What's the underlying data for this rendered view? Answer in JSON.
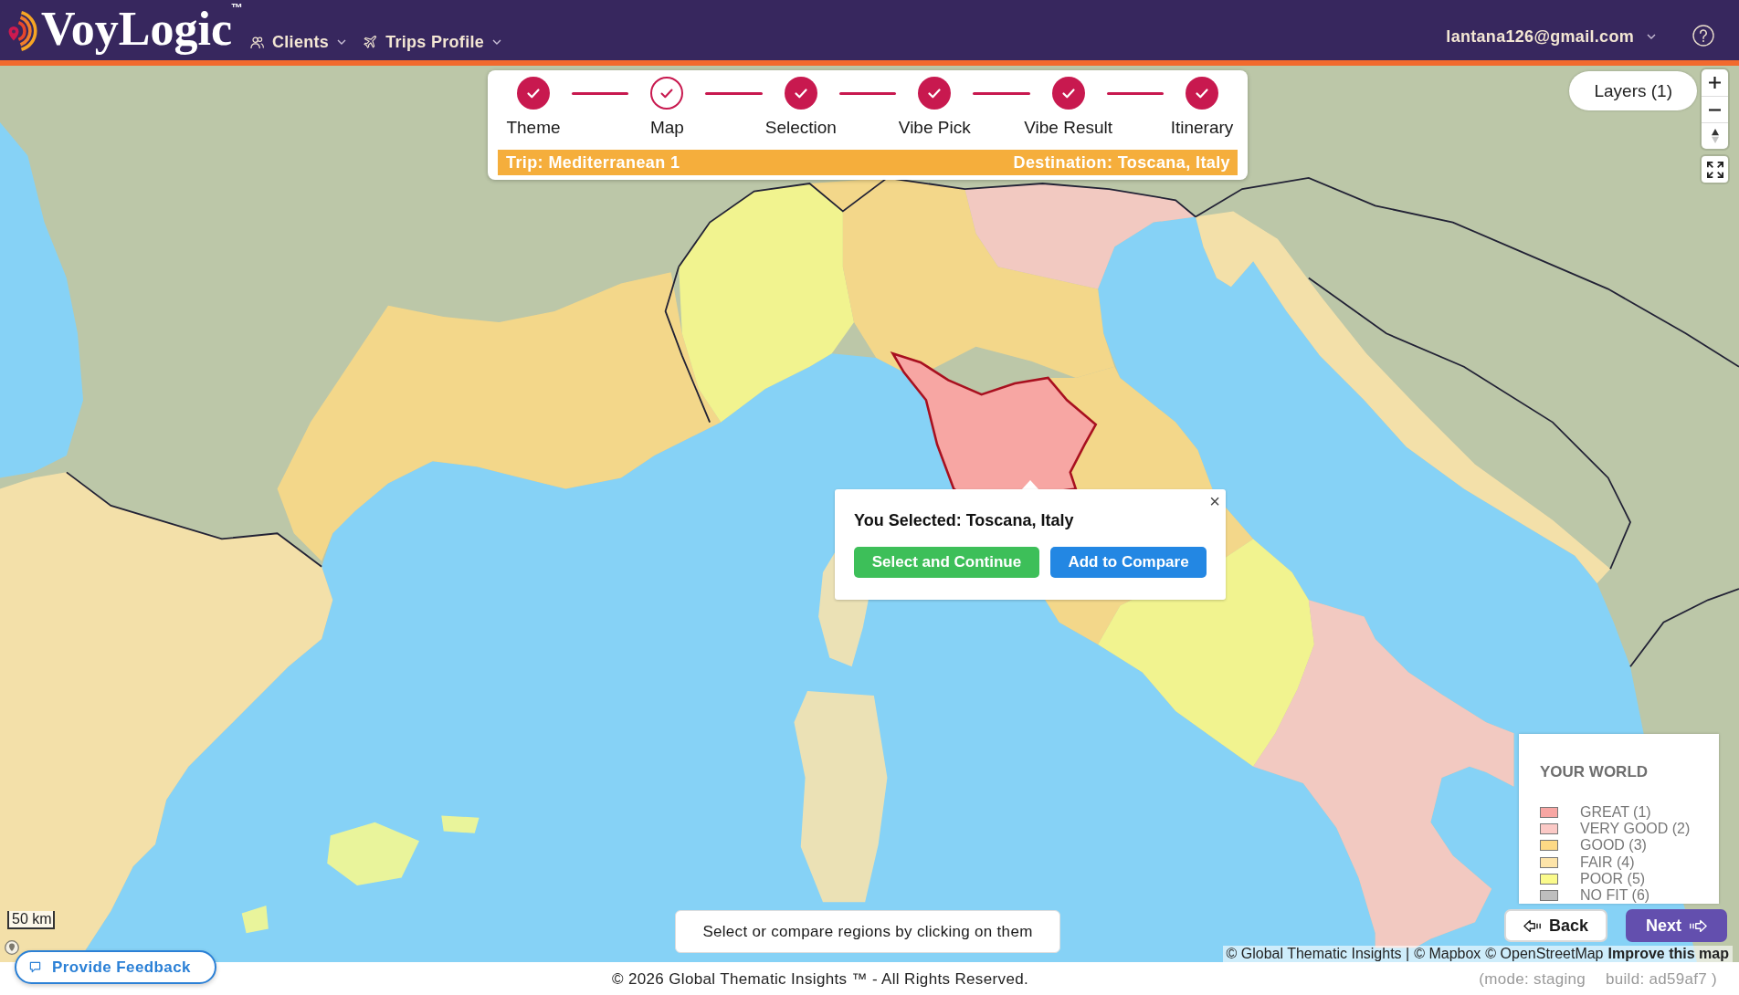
{
  "header": {
    "logo": {
      "name": "VoyLogic",
      "trademark": "™"
    },
    "nav": [
      {
        "label": "Clients",
        "kind": "people"
      },
      {
        "label": "Trips Profile",
        "kind": "plane"
      }
    ],
    "user_email": "lantana126@gmail.com"
  },
  "stepper": {
    "steps": [
      {
        "label": "Theme",
        "selected": false
      },
      {
        "label": "Map",
        "selected": true
      },
      {
        "label": "Selection",
        "selected": false
      },
      {
        "label": "Vibe Pick",
        "selected": false
      },
      {
        "label": "Vibe Result",
        "selected": false
      },
      {
        "label": "Itinerary",
        "selected": false
      }
    ],
    "trip": "Trip: Mediterranean 1",
    "destination": "Destination: Toscana, Italy"
  },
  "map": {
    "layers_button": "Layers (1)",
    "popup": {
      "title": "You Selected: Toscana, Italy",
      "close": "×",
      "buttons": [
        {
          "label": "Select and Continue",
          "kind": "select"
        },
        {
          "label": "Add to Compare",
          "kind": "compare"
        }
      ]
    },
    "legend": {
      "title": "YOUR WORLD",
      "items": [
        {
          "label": "GREAT (1)",
          "color": "#f7a6a3"
        },
        {
          "label": "VERY GOOD (2)",
          "color": "#fbc9c6"
        },
        {
          "label": "GOOD (3)",
          "color": "#fdd985"
        },
        {
          "label": "FAIR (4)",
          "color": "#fde4a9"
        },
        {
          "label": "POOR (5)",
          "color": "#fafa8b"
        },
        {
          "label": "NO FIT (6)",
          "color": "#bebebe"
        }
      ]
    },
    "nav_buttons": [
      {
        "label": "Back",
        "kind": "back"
      },
      {
        "label": "Next",
        "kind": "next"
      }
    ],
    "hint": "Select or compare regions by clicking on them",
    "scale": "50 km",
    "attribution": [
      {
        "text": "© Global Thematic Insights |",
        "kind": "text"
      },
      {
        "text": "© Mapbox",
        "kind": "link"
      },
      {
        "text": "© OpenStreetMap",
        "kind": "link"
      },
      {
        "text": "Improve this map",
        "kind": "strong"
      }
    ]
  },
  "feedback_button": "Provide Feedback",
  "footer": {
    "copyright": "© 2026 Global Thematic Insights ™ - All Rights Reserved.",
    "build_info": [
      "(mode: staging",
      "build: ad59af7 )"
    ]
  }
}
